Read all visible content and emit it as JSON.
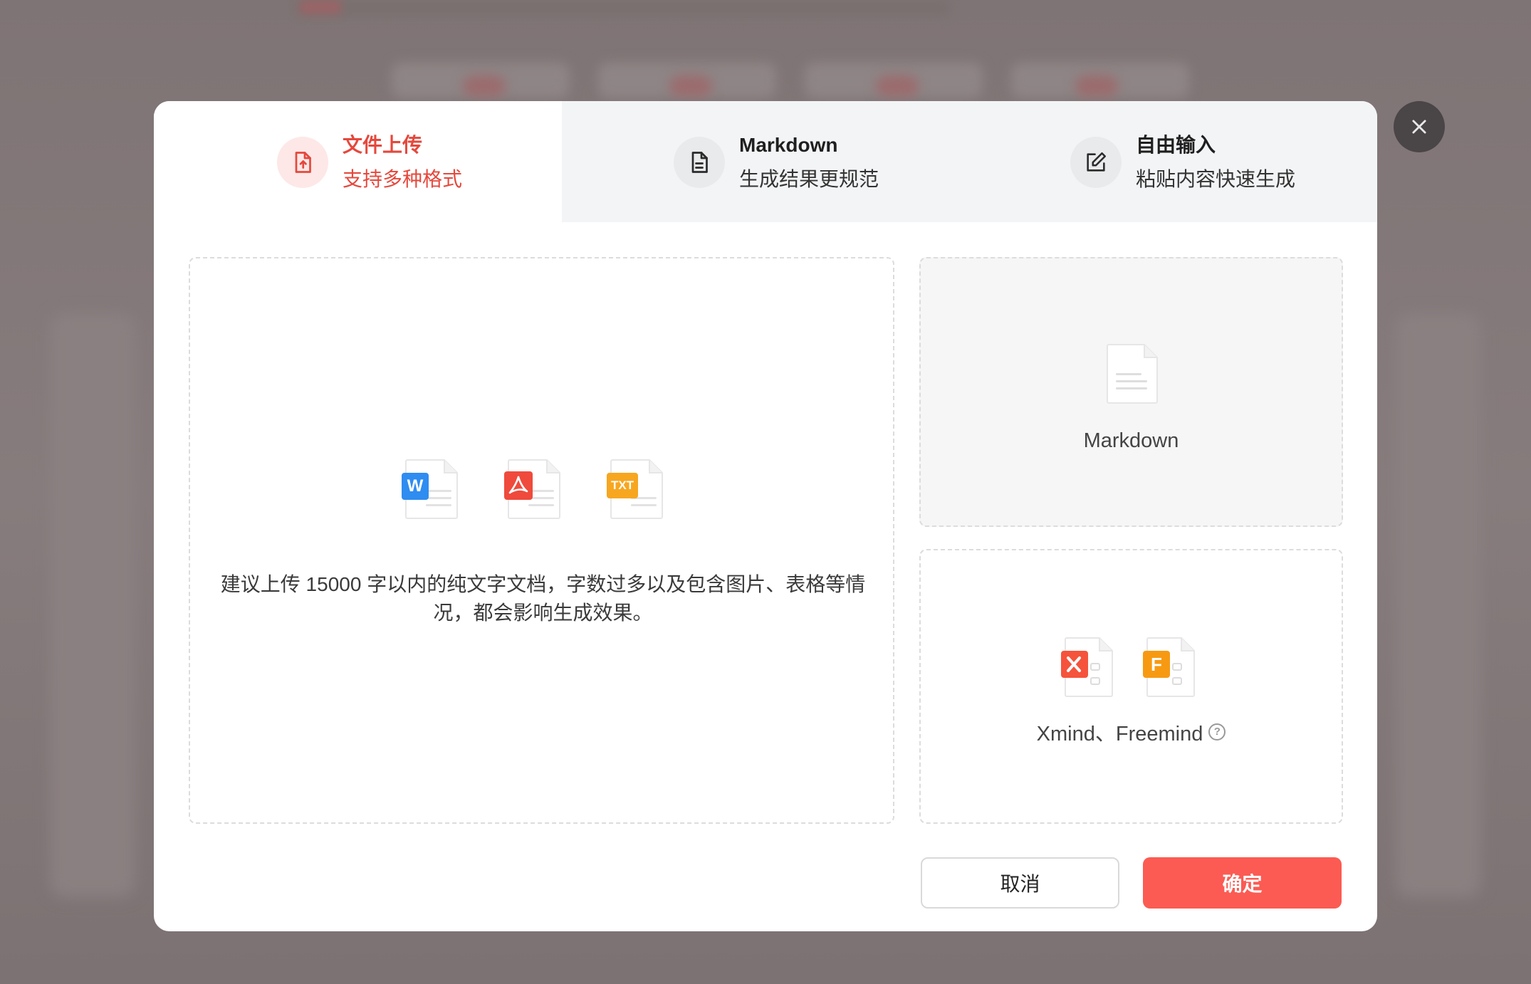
{
  "tabs": [
    {
      "title": "文件上传",
      "subtitle": "支持多种格式",
      "icon": "file-upload-icon",
      "active": true
    },
    {
      "title": "Markdown",
      "subtitle": "生成结果更规范",
      "icon": "document-lines-icon",
      "active": false
    },
    {
      "title": "自由输入",
      "subtitle": "粘贴内容快速生成",
      "icon": "edit-icon",
      "active": false
    }
  ],
  "upload": {
    "file_types": [
      {
        "name": "word-file-icon",
        "badge": "W",
        "color": "#2f8cf0"
      },
      {
        "name": "pdf-file-icon",
        "badge": "",
        "color": "#ef4a3c"
      },
      {
        "name": "txt-file-icon",
        "badge": "TXT",
        "color": "#f7a620"
      }
    ],
    "description": "建议上传 15000 字以内的纯文字文档，字数过多以及包含图片、表格等情况，都会影响生成效果。"
  },
  "markdown_option": {
    "label": "Markdown",
    "icon": "markdown-file-icon"
  },
  "mindmap_option": {
    "label": "Xmind、Freemind",
    "icons": [
      {
        "name": "xmind-file-icon",
        "color": "#f5533b"
      },
      {
        "name": "freemind-file-icon",
        "badge": "F",
        "color": "#f79a12"
      }
    ],
    "help_icon": "help-circle-icon",
    "help_glyph": "?"
  },
  "buttons": {
    "cancel": "取消",
    "confirm": "确定"
  },
  "close_icon": "close-icon",
  "colors": {
    "accent": "#e5483c",
    "confirm_bg": "#fb5b52",
    "tab_inactive_bg": "#f3f4f6",
    "overlay": "#857a7b"
  }
}
